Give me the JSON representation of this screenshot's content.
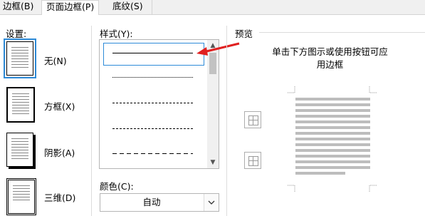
{
  "tabs": [
    {
      "label": "边框(B)"
    },
    {
      "label": "页面边框(P)"
    },
    {
      "label": "底纹(S)"
    }
  ],
  "setting": {
    "title": "设置:",
    "options": [
      {
        "label": "无(N)",
        "selected": true
      },
      {
        "label": "方框(X)"
      },
      {
        "label": "阴影(A)"
      },
      {
        "label": "三维(D)"
      }
    ]
  },
  "style": {
    "title": "样式(Y):",
    "samples": [
      "solid",
      "dotted",
      "dashed-fine",
      "dashed",
      "dash-long"
    ]
  },
  "color": {
    "title": "颜色(C):",
    "value": "自动"
  },
  "preview": {
    "title": "预览",
    "hint_line1": "单击下方图示或使用按钮可应",
    "hint_line2": "用边框"
  },
  "colors": {
    "selection_blue": "#2e8bd8",
    "arrow_red": "#e02020",
    "preview_bar": "#bdbdbd"
  }
}
